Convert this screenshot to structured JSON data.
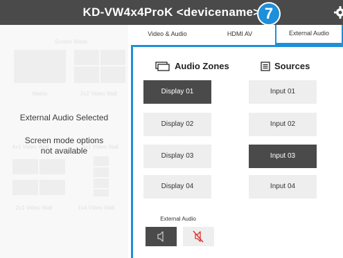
{
  "app": {
    "title": "KD-VW4x4ProK <devicename>",
    "callout_number": "7"
  },
  "tabs": [
    {
      "label": "Video & Audio",
      "active": false
    },
    {
      "label": "HDMI AV",
      "active": false
    },
    {
      "label": "External Audio",
      "active": true
    }
  ],
  "left_panel": {
    "section_label": "Screen Mode",
    "mode_labels": [
      "Matrix",
      "2x2 Video Wall",
      "4x1 Video Wall",
      "4x1 Video Wall",
      "2x1 Video Wall",
      "1x4 Video Wall"
    ],
    "status_text": "External Audio Selected",
    "notice_line1": "Screen mode options",
    "notice_line2": "not available"
  },
  "audio_zones": {
    "heading": "Audio Zones",
    "icon": "display-icon",
    "items": [
      {
        "label": "Display 01",
        "selected": true
      },
      {
        "label": "Display 02",
        "selected": false
      },
      {
        "label": "Display 03",
        "selected": false
      },
      {
        "label": "Display 04",
        "selected": false
      }
    ]
  },
  "sources": {
    "heading": "Sources",
    "icon": "sources-list-icon",
    "items": [
      {
        "label": "Input 01",
        "selected": false
      },
      {
        "label": "Input 02",
        "selected": false
      },
      {
        "label": "Input 03",
        "selected": true
      },
      {
        "label": "Input 04",
        "selected": false
      }
    ]
  },
  "external_audio": {
    "label": "External Audio",
    "speaker_icon": "speaker-icon",
    "mute_icon": "mute-icon"
  },
  "colors": {
    "accent": "#1e8fd9",
    "selected": "#4a4a4a",
    "button": "#eeeeee",
    "mute_icon": "#e0302a"
  }
}
